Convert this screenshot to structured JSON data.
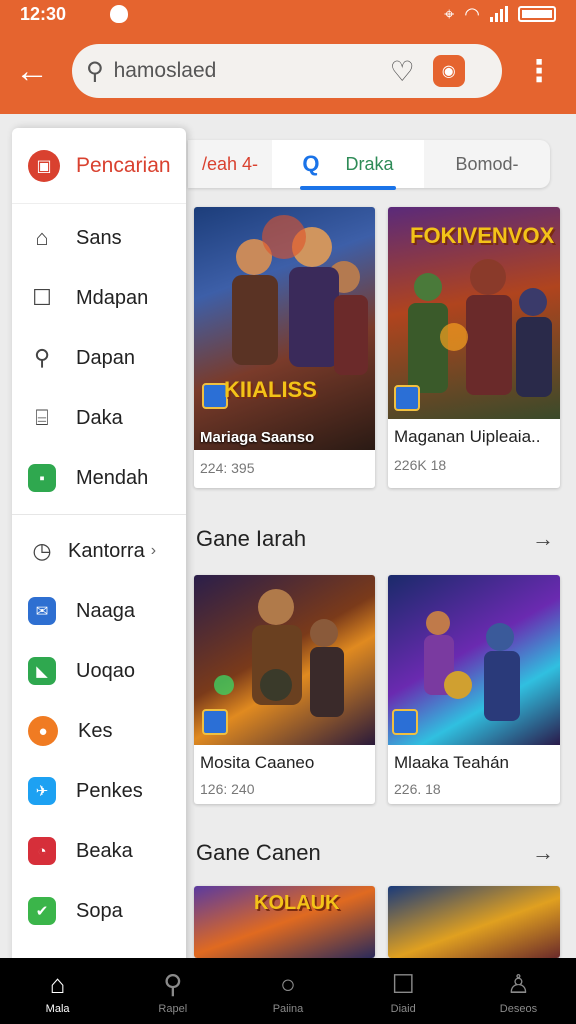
{
  "status": {
    "time": "12:30"
  },
  "search": {
    "value": "hamoslaed"
  },
  "drawer": {
    "header": "Pencarian",
    "items": [
      {
        "label": "Sans",
        "icon": "home-outline-icon"
      },
      {
        "label": "Mdapan",
        "icon": "square-outline-icon"
      },
      {
        "label": "Dapan",
        "icon": "search-icon"
      },
      {
        "label": "Daka",
        "icon": "folder-icon"
      },
      {
        "label": "Mendah",
        "icon": "green-app-icon"
      }
    ],
    "section_label": "Kantorra",
    "apps": [
      {
        "label": "Naaga",
        "icon": "mail-icon",
        "color": "#2e6fd1"
      },
      {
        "label": "Uoqao",
        "icon": "chat-icon",
        "color": "#2fa84f"
      },
      {
        "label": "Kes",
        "icon": "orange-circle-icon",
        "color": "#f07b22"
      },
      {
        "label": "Penkes",
        "icon": "bird-icon",
        "color": "#1da1f2"
      },
      {
        "label": "Beaka",
        "icon": "red-app-icon",
        "color": "#d62f3a"
      },
      {
        "label": "Sopa",
        "icon": "leaf-icon",
        "color": "#3bb54a"
      }
    ]
  },
  "tabs": [
    {
      "label": "/eah 4-"
    },
    {
      "label": "Draka"
    },
    {
      "label": "Bomod-"
    }
  ],
  "featured": [
    {
      "title": "Mariaga Saanso",
      "overlay": "KIIALISS",
      "meta": "224: 395"
    },
    {
      "title": "Maganan Uipleaia..",
      "overlay": "FOKIVENVOX",
      "meta": "226K 18"
    }
  ],
  "section1": {
    "title": "Gane Iarah",
    "cards": [
      {
        "title": "Mosita Caaneo",
        "meta": "126: 240"
      },
      {
        "title": "Mlaaka Teahán",
        "meta": "226. 18"
      }
    ]
  },
  "section2": {
    "title": "Gane Canen",
    "cards": [
      {
        "overlay": "KOLAUK"
      },
      {
        "overlay": ""
      }
    ]
  },
  "nav": [
    {
      "label": "Mala",
      "icon": "home-icon"
    },
    {
      "label": "Rapel",
      "icon": "search-icon"
    },
    {
      "label": "Paiina",
      "icon": "circle-icon"
    },
    {
      "label": "Diaid",
      "icon": "square-icon"
    },
    {
      "label": "Deseos",
      "icon": "person-icon"
    }
  ],
  "colors": {
    "accent": "#e5642f",
    "drawer_accent": "#d9412f",
    "tab_indicator": "#1a73e8"
  }
}
